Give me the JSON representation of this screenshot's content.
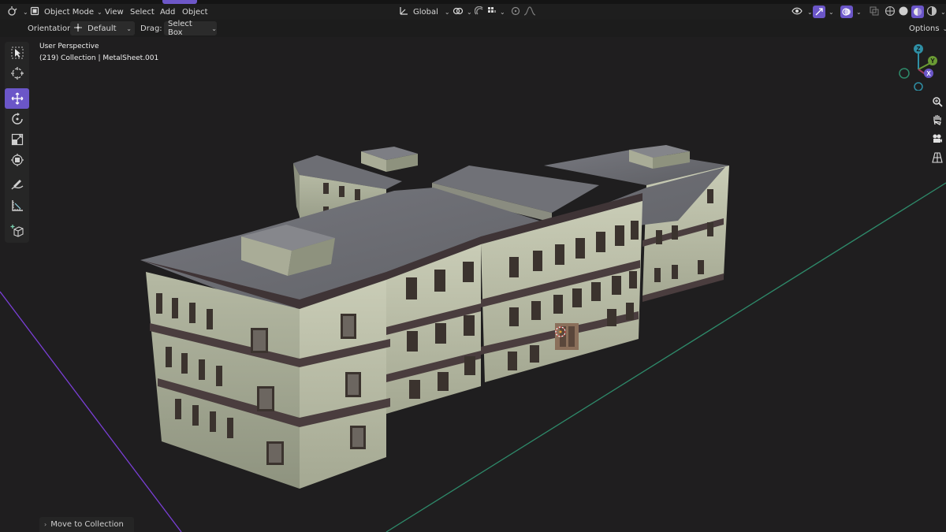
{
  "header": {
    "mode_label": "Object Mode",
    "menus": [
      "View",
      "Select",
      "Add",
      "Object"
    ],
    "transform_orientation": "Global"
  },
  "toolbar": {
    "orientation_label": "Orientation:",
    "orientation_value": "Default",
    "drag_label": "Drag:",
    "drag_value": "Select Box",
    "options_label": "Options"
  },
  "viewport": {
    "view_name": "User Perspective",
    "collection_info": "(219) Collection | MetalSheet.001"
  },
  "gizmo": {
    "axis_z": "Z",
    "axis_y": "Y",
    "axis_x": "X"
  },
  "last_operation": {
    "label": "Move to Collection"
  },
  "left_toolbar": {
    "tools": [
      "select-box-icon",
      "cursor-icon",
      "move-icon",
      "rotate-icon",
      "scale-icon",
      "transform-icon",
      "annotate-icon",
      "measure-icon",
      "add-cube-icon"
    ],
    "active_tool": "move-icon"
  },
  "colors": {
    "accent": "#6b56c8",
    "x_axis": "#9a3b5e",
    "y_axis": "#6a9b34",
    "z_axis": "#2f8fa5",
    "floor_line_x": "#7a3fd6",
    "floor_line_y": "#2e8a6a"
  }
}
